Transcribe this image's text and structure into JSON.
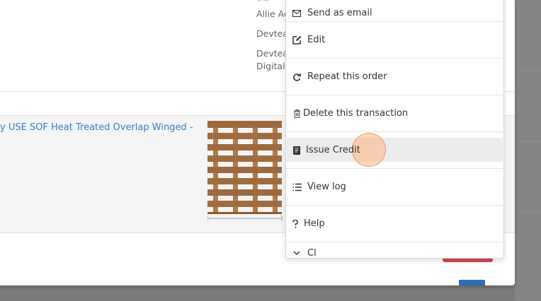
{
  "order": {
    "contact_name": "Allie Ac",
    "company_line_1": "Devtea",
    "company_line_2": "Devtea",
    "company_line_3": "Digital F"
  },
  "line_item": {
    "product_link": "y USE SOF Heat Treated Overlap Winged -",
    "image_icon": "wooden-pallet-image"
  },
  "menu": {
    "items": [
      {
        "label": "Send as email",
        "icon": "envelope-icon"
      },
      {
        "label": "Edit",
        "icon": "edit-icon"
      },
      {
        "label": "Repeat this order",
        "icon": "redo-icon"
      },
      {
        "label": "Delete this transaction",
        "icon": "trash-icon"
      },
      {
        "label": "Issue Credit",
        "icon": "credit-note-icon",
        "highlighted": true
      },
      {
        "label": "View log",
        "icon": "list-icon"
      },
      {
        "label": "Help",
        "icon": "question-icon"
      },
      {
        "label": "Cl",
        "icon": "chevron-down-icon"
      }
    ]
  },
  "colors": {
    "link": "#3b7dc4",
    "danger": "#d9414e",
    "primary": "#2f6fb6",
    "highlight": "#ececec",
    "click_indicator": "#f5a46a"
  }
}
